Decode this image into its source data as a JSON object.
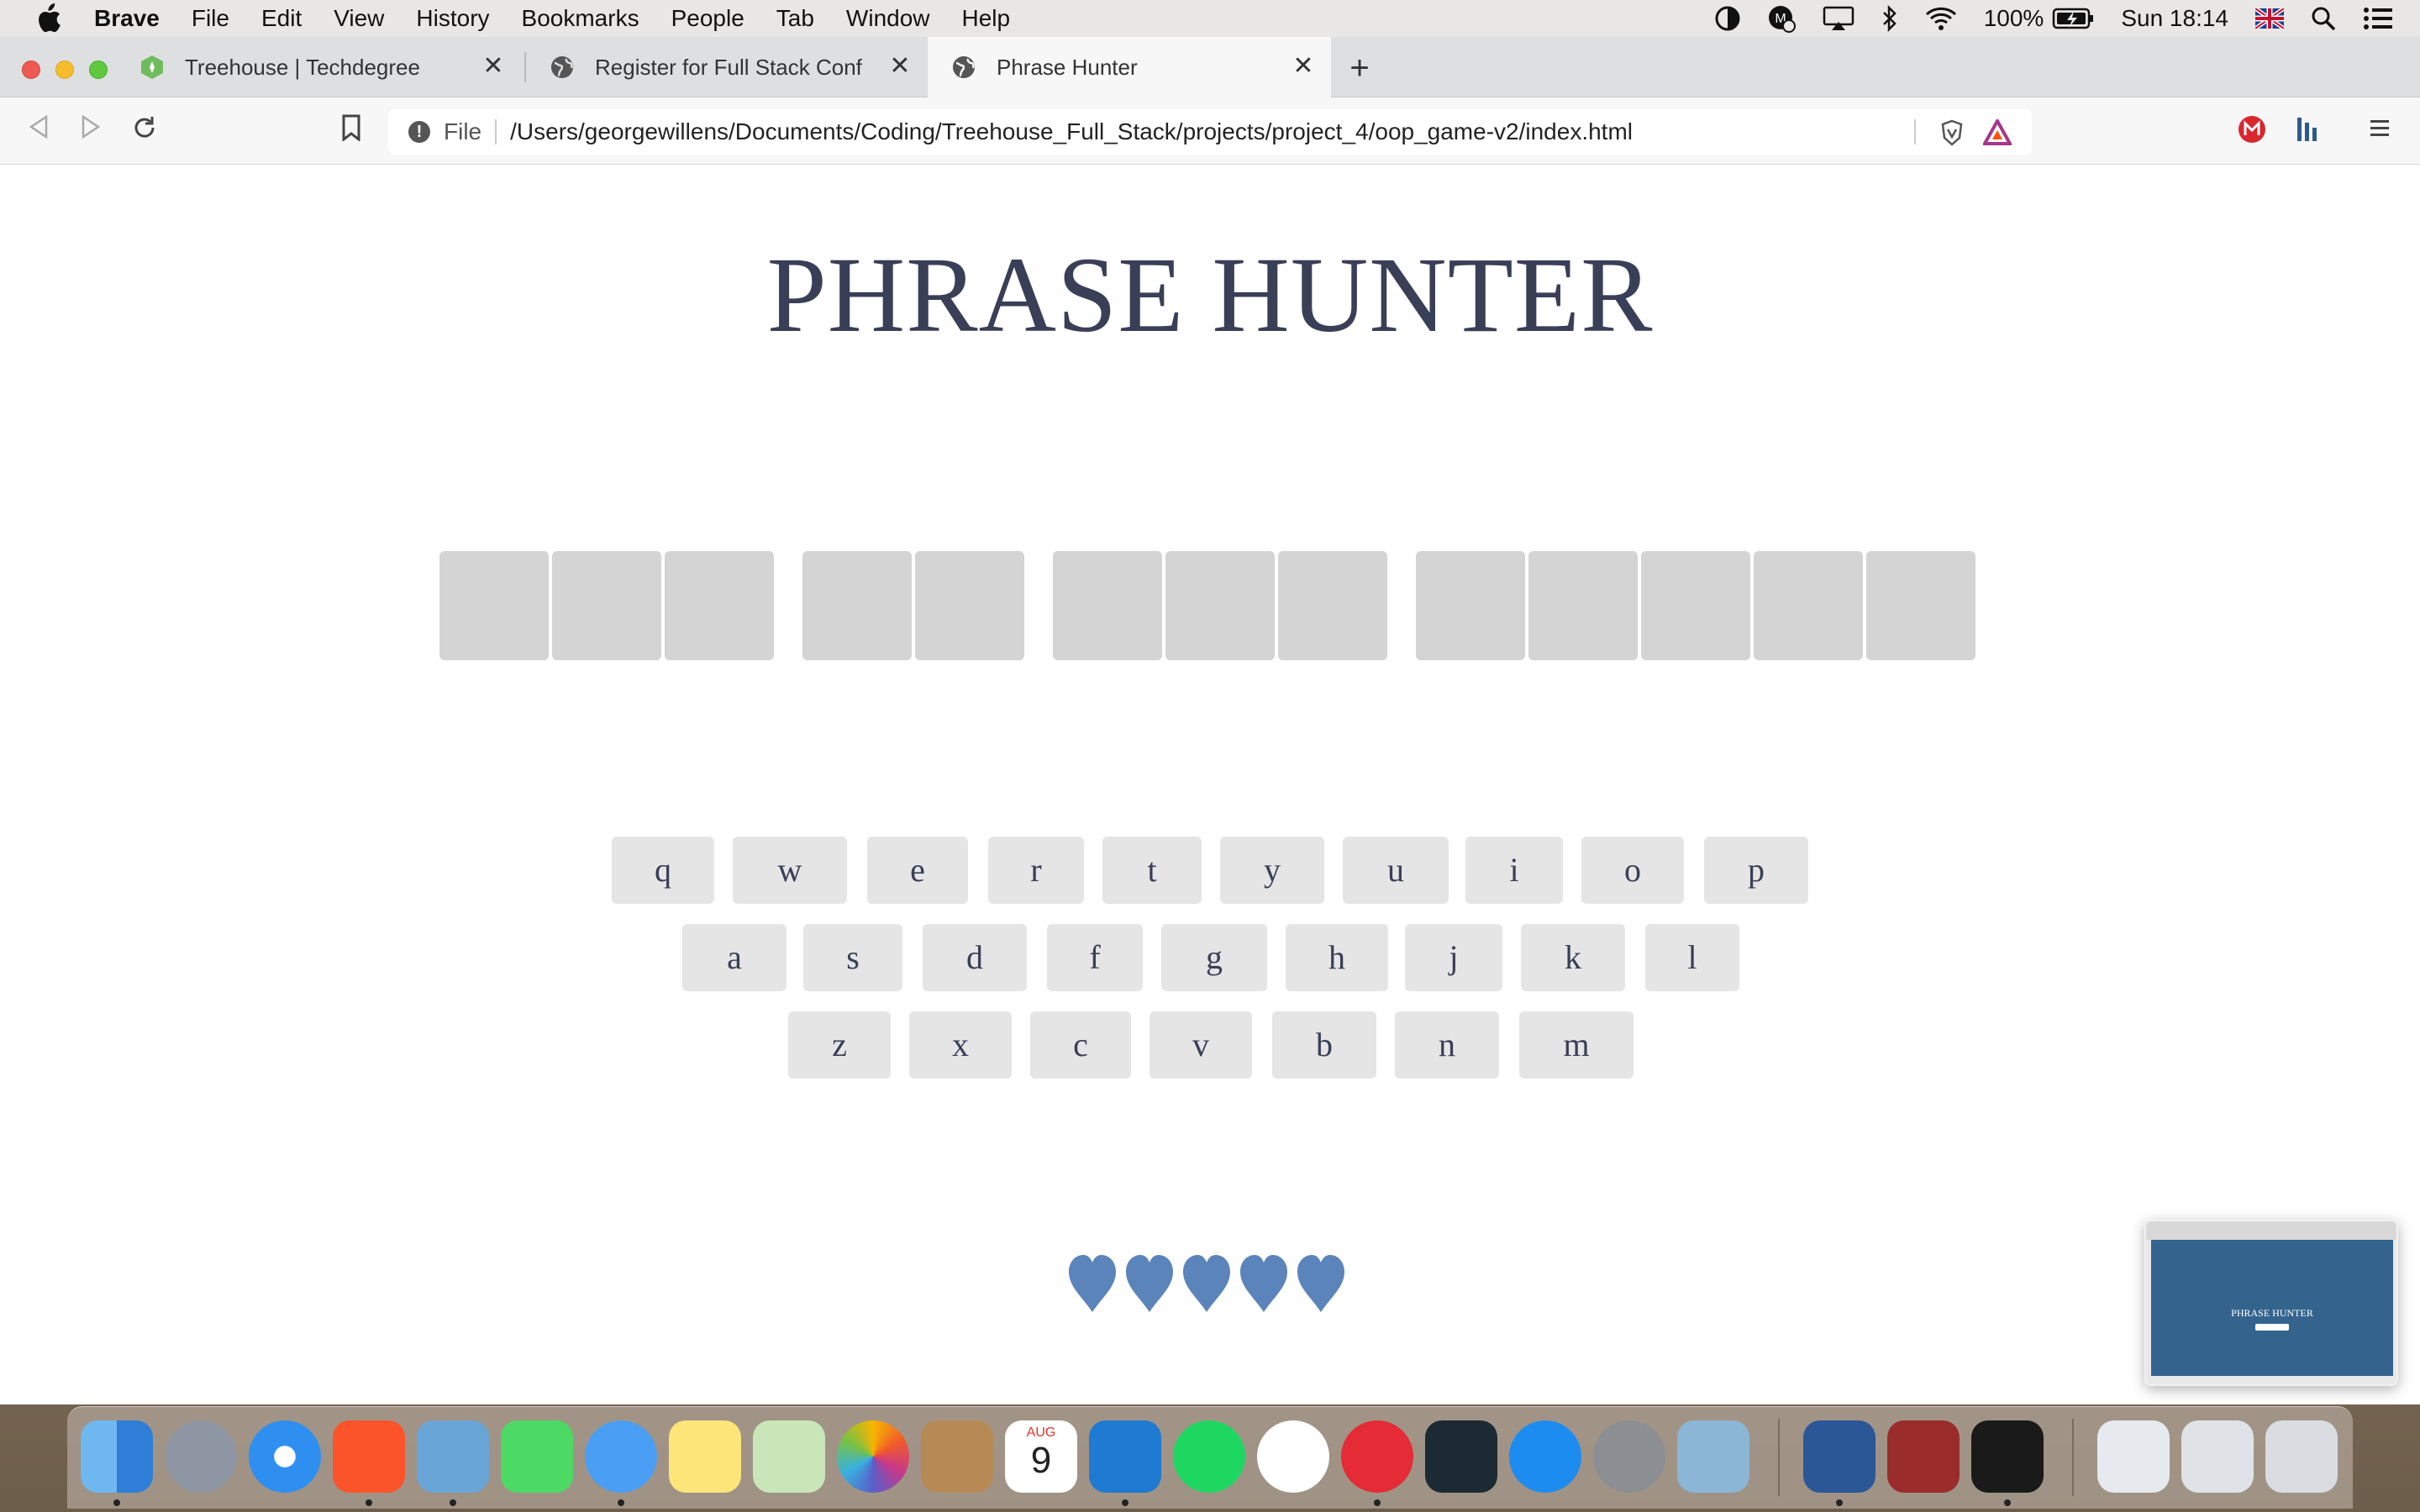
{
  "menubar": {
    "app_name": "Brave",
    "items": [
      "File",
      "Edit",
      "View",
      "History",
      "Bookmarks",
      "People",
      "Tab",
      "Window",
      "Help"
    ],
    "battery": "100%",
    "clock": "Sun 18:14"
  },
  "tabs": [
    {
      "label": "Treehouse | Techdegree",
      "active": false
    },
    {
      "label": "Register for Full Stack Conf",
      "active": false
    },
    {
      "label": "Phrase Hunter",
      "active": true
    }
  ],
  "address_bar": {
    "scheme_label": "File",
    "url": "/Users/georgewillens/Documents/Coding/Treehouse_Full_Stack/projects/project_4/oop_game-v2/index.html"
  },
  "game": {
    "title": "PHRASE HUNTER",
    "phrase_word_lengths": [
      3,
      2,
      3,
      5
    ],
    "keyboard_rows": [
      [
        "q",
        "w",
        "e",
        "r",
        "t",
        "y",
        "u",
        "i",
        "o",
        "p"
      ],
      [
        "a",
        "s",
        "d",
        "f",
        "g",
        "h",
        "j",
        "k",
        "l"
      ],
      [
        "z",
        "x",
        "c",
        "v",
        "b",
        "n",
        "m"
      ]
    ],
    "lives_remaining": 5,
    "colors": {
      "title": "#3a3f58",
      "letter_box": "#d4d4d4",
      "key": "#e5e5e5",
      "heart": "#5b84bb"
    }
  },
  "thumbnail": {
    "title": "PHRASE HUNTER"
  },
  "dock": {
    "calendar_month": "AUG",
    "calendar_day": "9"
  }
}
